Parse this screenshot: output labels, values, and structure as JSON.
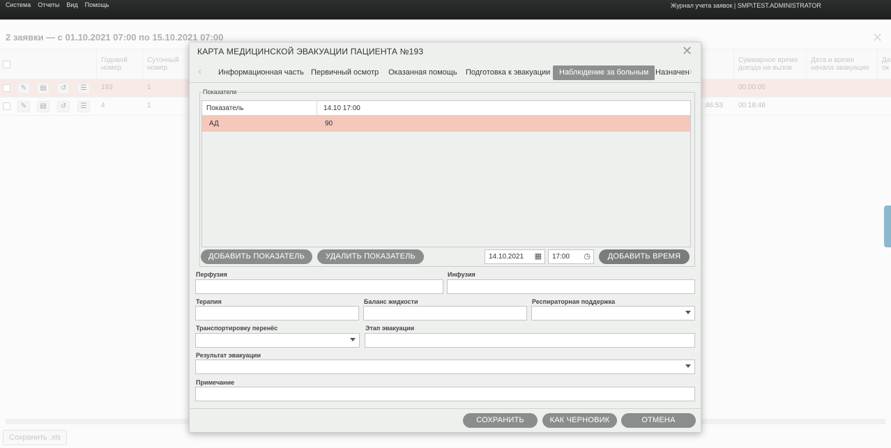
{
  "topbar": {
    "menu": [
      "Система",
      "Отчеты",
      "Вид",
      "Помощь"
    ],
    "user_info": "Журнал учета заявок | SMP\\TEST.ADMINISTRATOR"
  },
  "background": {
    "title": "2 заявки — с 01.10.2021 07:00 по 15.10.2021 07:00",
    "columns": [
      "Годовой номер",
      "Суточный номер",
      "Суммарное время доезда на вызов",
      "Дата и время начала эвакуации",
      "Да ок"
    ],
    "rows": [
      {
        "annual": "193",
        "daily": "1",
        "time": "",
        "total": "00:00:00"
      },
      {
        "annual": "4",
        "daily": "1",
        "time": ":46:53",
        "total": "00:18:46"
      }
    ],
    "save_xls": "Сохранить .xls"
  },
  "modal": {
    "title": "КАРТА МЕДИЦИНСКОЙ ЭВАКУАЦИИ ПАЦИЕНТА №193",
    "tabs": [
      "Информационная часть",
      "Первичный осмотр",
      "Оказанная помощь",
      "Подготовка к эвакуации",
      "Наблюдение за больным",
      "Назначен"
    ],
    "active_tab": "Наблюдение за больным",
    "indicators": {
      "legend": "Показатели",
      "columns": [
        "Показатель",
        "14.10 17:00"
      ],
      "rows": [
        {
          "name": "АД",
          "value": "90"
        }
      ]
    },
    "buttons": {
      "add_indicator": "ДОБАВИТЬ ПОКАЗАТЕЛЬ",
      "remove_indicator": "УДАЛИТЬ ПОКАЗАТЕЛЬ",
      "add_time": "ДОБАВИТЬ ВРЕМЯ",
      "save": "СОХРАНИТЬ",
      "draft": "КАК ЧЕРНОВИК",
      "cancel": "ОТМЕНА"
    },
    "date_value": "14.10.2021",
    "time_value": "17:00",
    "fields": {
      "perfusion": {
        "label": "Перфузия",
        "value": ""
      },
      "infusion": {
        "label": "Инфузия",
        "value": ""
      },
      "therapy": {
        "label": "Терапия",
        "value": ""
      },
      "fluid_balance": {
        "label": "Баланс жидкости",
        "value": ""
      },
      "respiratory_support": {
        "label": "Респираторная поддержка",
        "value": ""
      },
      "transport_tolerance": {
        "label": "Транспортировку перенёс",
        "value": ""
      },
      "evacuation_stage": {
        "label": "Этап эвакуации",
        "value": ""
      },
      "evacuation_result": {
        "label": "Результат эвакуации",
        "value": ""
      },
      "note": {
        "label": "Примечание",
        "value": ""
      }
    }
  }
}
